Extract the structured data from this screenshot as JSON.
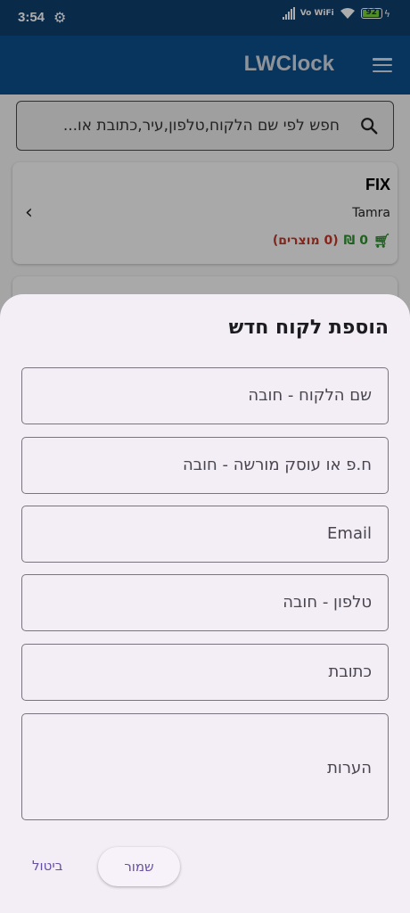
{
  "status_bar": {
    "time": "3:54",
    "network": "Vo WiFi",
    "battery": "92"
  },
  "app_bar": {
    "title": "LWClock"
  },
  "search": {
    "placeholder": "חפש לפי שם הלקוח,טלפון,עיר,כתובת או..."
  },
  "customer_card": {
    "name": "FIX",
    "city": "Tamra",
    "amount": "0 ₪",
    "items": "(0 מוצרים)"
  },
  "dialog": {
    "title": "הוספת לקוח חדש",
    "fields": [
      {
        "label": "שם הלקוח - חובה"
      },
      {
        "label": "ח.פ או עוסק מורשה - חובה"
      },
      {
        "label": "Email"
      },
      {
        "label": "טלפון - חובה"
      },
      {
        "label": "כתובת"
      },
      {
        "label": "הערות"
      }
    ],
    "save_label": "שמור",
    "cancel_label": "ביטול"
  },
  "colors": {
    "app_bar": "#0b4f8a",
    "sheet": "#f3eef6",
    "accent": "#6750a4",
    "amount": "#2f8f2f",
    "items": "#c0392b"
  }
}
